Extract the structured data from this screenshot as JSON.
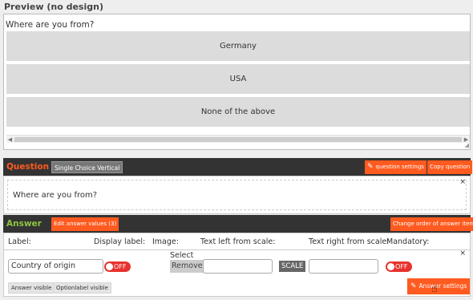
{
  "preview": {
    "title": "Preview (no design)",
    "question": "Where are you from?",
    "choices": [
      "Germany",
      "USA",
      "None of the above"
    ]
  },
  "question_bar": {
    "title": "Question",
    "type_tag": "Single Choice Vertical",
    "settings_button": "question settings",
    "copy_button": "Copy question"
  },
  "question_body": {
    "text": "Where are you from?",
    "close": "×"
  },
  "answer_bar": {
    "title": "Answer",
    "edit_button": "Edit answer values (3)",
    "order_button": "Change order of answer items"
  },
  "answer_table": {
    "headers": {
      "label": "Label:",
      "display_label": "Display label:",
      "image": "Image:",
      "text_left": "Text left from scale:",
      "text_right": "Text right from scale:",
      "mandatory": "Mandatory:"
    },
    "row": {
      "label_value": "Country of origin",
      "display_toggle": "OFF",
      "select_label": "Select",
      "remove_button": "Remove",
      "text_left_value": "",
      "scale_button": "SCALE",
      "text_right_value": "",
      "mandatory_toggle": "OFF",
      "close": "×"
    },
    "tags": {
      "answer_visible": "Answer visible",
      "optionlabel_visible": "Optionlabel visible"
    },
    "settings_button": "Answer settings"
  },
  "icons": {
    "pencil": "pencil-icon",
    "hand": "hand-cursor-icon"
  },
  "colors": {
    "accent_orange": "#ff5a1f",
    "answer_green": "#8cc63f",
    "dark_bar": "#333333",
    "toggle_off": "#e8322d"
  }
}
